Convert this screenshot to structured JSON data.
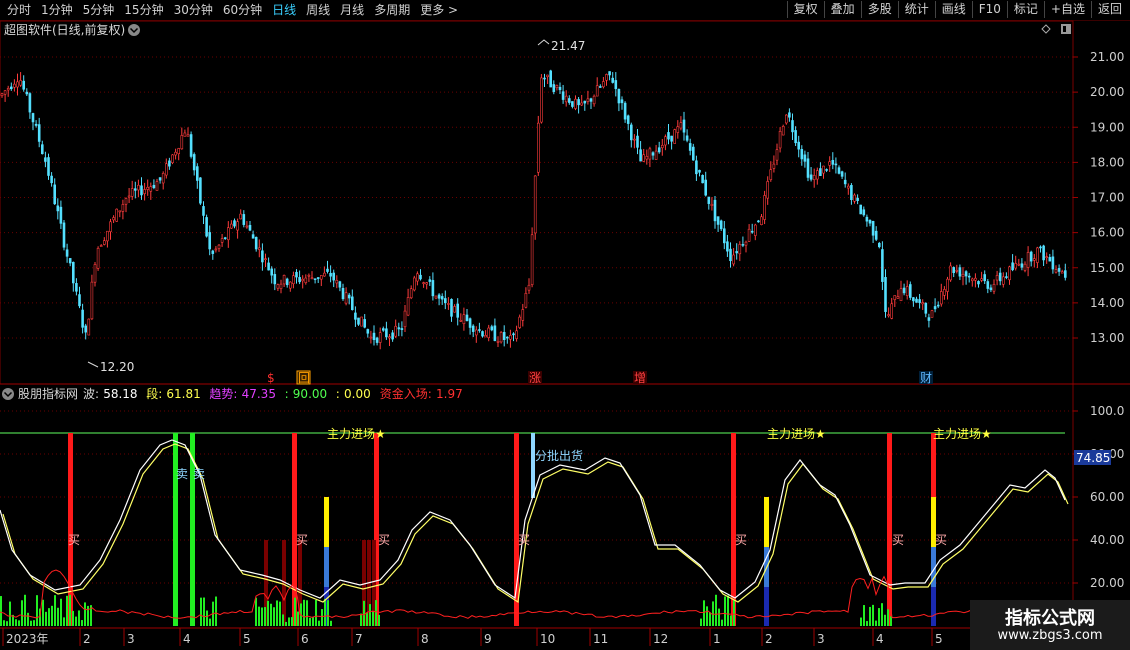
{
  "toolbar": {
    "periods": [
      "分时",
      "1分钟",
      "5分钟",
      "15分钟",
      "30分钟",
      "60分钟",
      "日线",
      "周线",
      "月线",
      "多周期",
      "更多 >"
    ],
    "active_period": "日线",
    "actions": [
      "复权",
      "叠加",
      "多股",
      "统计",
      "画线",
      "F10",
      "标记",
      "+自选",
      "返回"
    ]
  },
  "main_panel": {
    "title": "超图软件(日线,前复权)",
    "high_label": "21.47",
    "low_label": "12.20",
    "price_ticks": [
      "21.00",
      "20.00",
      "19.00",
      "18.00",
      "17.00",
      "16.00",
      "15.00",
      "14.00",
      "13.00"
    ],
    "event_markers": [
      {
        "label": "$",
        "color": "#ff3030"
      },
      {
        "label": "回",
        "color": "#ffa000"
      },
      {
        "label": "涨",
        "color": "#ff4040"
      },
      {
        "label": "增",
        "color": "#ff4040"
      },
      {
        "label": "财",
        "color": "#60b8ff"
      }
    ]
  },
  "indicator_panel": {
    "title": "股朋指标网",
    "readouts": [
      {
        "label": "波:",
        "value": "58.18",
        "color": "#ffffff"
      },
      {
        "label": "段:",
        "value": "61.81",
        "color": "#ffff50"
      },
      {
        "label": "趋势:",
        "value": "47.35",
        "color": "#e040ff"
      },
      {
        "label": ":",
        "value": "90.00",
        "color": "#50ff50"
      },
      {
        "label": ":",
        "value": "0.00",
        "color": "#ffff50"
      },
      {
        "label": "资金入场:",
        "value": "1.97",
        "color": "#ff3030"
      }
    ],
    "value_ticks": [
      "100.0",
      "80.00",
      "60.00",
      "40.00",
      "20.00"
    ],
    "current_value": "74.85",
    "annotations": {
      "main_force": "主力进场★",
      "batch_sell": "分批出货",
      "buy": "买",
      "sell": "卖"
    }
  },
  "date_axis": {
    "labels": [
      "2023年",
      "2",
      "3",
      "4",
      "5",
      "6",
      "7",
      "8",
      "9",
      "10",
      "11",
      "12",
      "1",
      "2",
      "3",
      "4",
      "5"
    ]
  },
  "watermark": {
    "line1": "指标公式网",
    "line2": "www.zbgs3.com"
  },
  "chart_data": {
    "type": "candlestick",
    "y_range": [
      12.2,
      21.47
    ],
    "high": 21.47,
    "low": 12.2,
    "approx_close_path": [
      {
        "x": 0,
        "y": 19.9
      },
      {
        "x": 18,
        "y": 20.5
      },
      {
        "x": 45,
        "y": 18.0
      },
      {
        "x": 85,
        "y": 13.0
      },
      {
        "x": 95,
        "y": 15.5
      },
      {
        "x": 125,
        "y": 17.0
      },
      {
        "x": 160,
        "y": 17.5
      },
      {
        "x": 185,
        "y": 19.0
      },
      {
        "x": 210,
        "y": 15.3
      },
      {
        "x": 240,
        "y": 16.5
      },
      {
        "x": 275,
        "y": 14.6
      },
      {
        "x": 330,
        "y": 14.8
      },
      {
        "x": 370,
        "y": 13.0
      },
      {
        "x": 400,
        "y": 13.2
      },
      {
        "x": 415,
        "y": 15.0
      },
      {
        "x": 440,
        "y": 14.0
      },
      {
        "x": 480,
        "y": 13.2
      },
      {
        "x": 512,
        "y": 12.9
      },
      {
        "x": 528,
        "y": 14.5
      },
      {
        "x": 540,
        "y": 20.5
      },
      {
        "x": 580,
        "y": 19.5
      },
      {
        "x": 610,
        "y": 20.5
      },
      {
        "x": 640,
        "y": 18.0
      },
      {
        "x": 680,
        "y": 19.0
      },
      {
        "x": 700,
        "y": 17.5
      },
      {
        "x": 730,
        "y": 15.3
      },
      {
        "x": 760,
        "y": 16.5
      },
      {
        "x": 785,
        "y": 19.5
      },
      {
        "x": 810,
        "y": 17.5
      },
      {
        "x": 830,
        "y": 18.0
      },
      {
        "x": 878,
        "y": 15.8
      },
      {
        "x": 885,
        "y": 13.5
      },
      {
        "x": 900,
        "y": 14.5
      },
      {
        "x": 930,
        "y": 13.6
      },
      {
        "x": 950,
        "y": 15.0
      },
      {
        "x": 990,
        "y": 14.5
      },
      {
        "x": 1037,
        "y": 15.5
      },
      {
        "x": 1065,
        "y": 14.8
      }
    ],
    "indicator": {
      "current": 74.85,
      "y_range": [
        0,
        100
      ],
      "threshold_line": 90
    }
  }
}
